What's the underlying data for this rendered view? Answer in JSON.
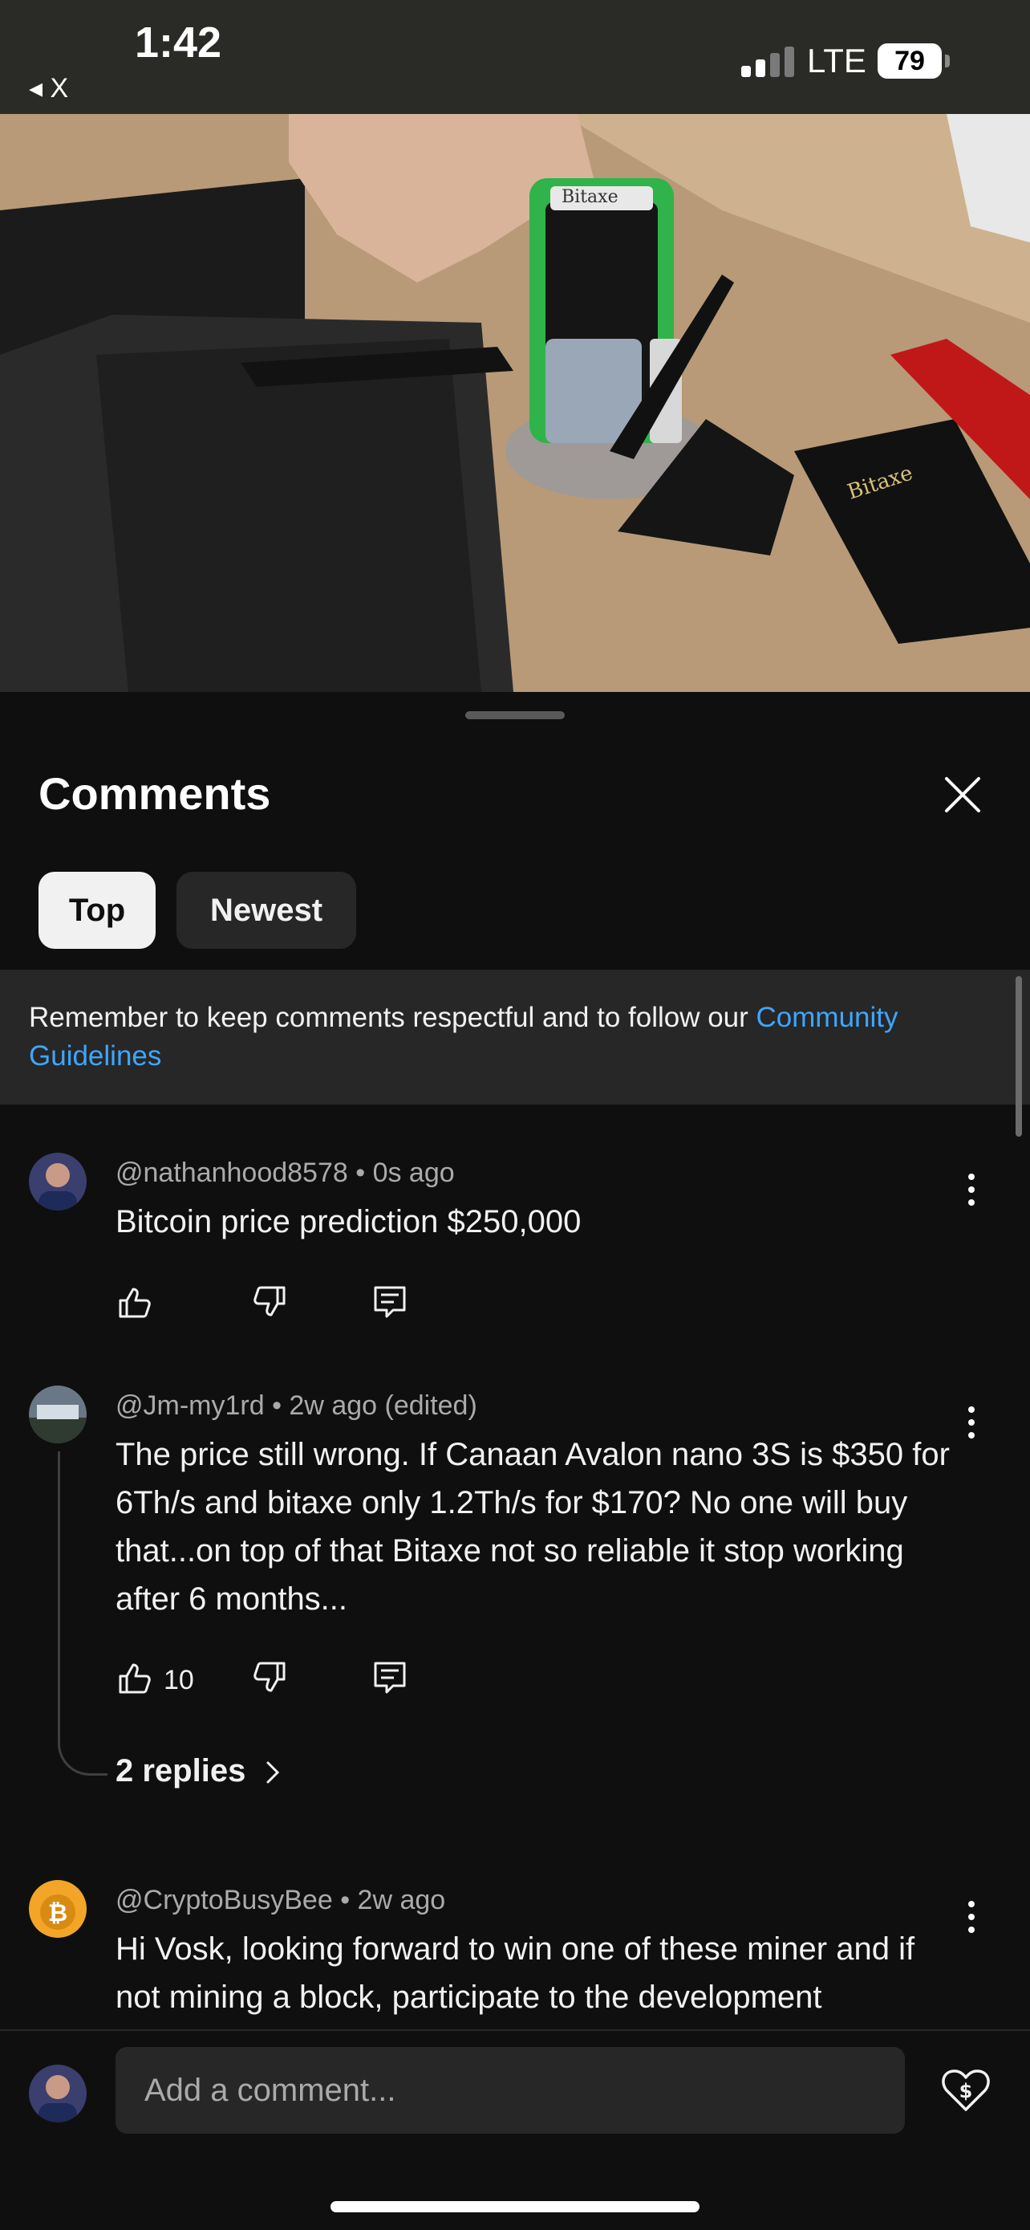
{
  "status_bar": {
    "time": "1:42",
    "back_app": "◂ X",
    "network": "LTE",
    "battery": "79"
  },
  "video": {
    "progress_fraction": 0.067,
    "scene_text_box": "Bitaxe",
    "scene_text_board": "Bitaxe"
  },
  "comments_panel": {
    "title": "Comments",
    "filters": [
      "Top",
      "Newest"
    ],
    "selected_filter": "Top",
    "guidelines_text": "Remember to keep comments respectful and to follow our ",
    "guidelines_link": "Community Guidelines"
  },
  "comments": [
    {
      "author": "@nathanhood8578",
      "time": "0s ago",
      "text": "Bitcoin price prediction $250,000",
      "likes": ""
    },
    {
      "author": "@Jm-my1rd",
      "time": "2w ago (edited)",
      "text": "The price still wrong. If Canaan Avalon nano 3S is $350 for 6Th/s and bitaxe only 1.2Th/s for $170? No one will buy that...on top of that Bitaxe not so reliable it stop working after 6 months...",
      "likes": "10",
      "replies": "2 replies"
    },
    {
      "author": "@CryptoBusyBee",
      "time": "2w ago",
      "text": "Hi Vosk, looking forward to win one of these miner and if not mining a block, participate to the development"
    }
  ],
  "composer": {
    "placeholder": "Add a comment..."
  },
  "colors": {
    "background": "#0f0f0f",
    "chip_selected": "#f1f1f1",
    "chip_unselected": "#272727",
    "link": "#3ea6ff",
    "meta_text": "#aaaaaa"
  }
}
